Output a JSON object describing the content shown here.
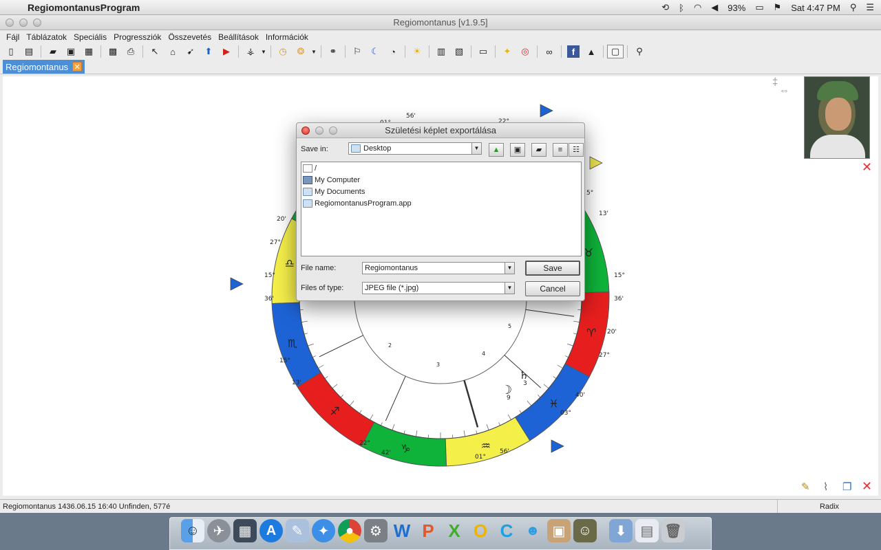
{
  "menubar": {
    "app_name": "RegiomontanusProgram",
    "battery": "93%",
    "clock": "Sat 4:47 PM"
  },
  "window": {
    "title": "Regiomontanus [v1.9.5]",
    "menu": [
      "Fájl",
      "Táblázatok",
      "Speciális",
      "Progressziók",
      "Összevetés",
      "Beállítások",
      "Információk"
    ],
    "tab_label": "Regiomontanus"
  },
  "chart_labels": {
    "top_left_deg": "56'",
    "top_left_minute": "01°",
    "top_right": "22°",
    "right_upper_1": "5°",
    "right_upper_2": "13'",
    "right_15": "15°",
    "right_36": "36'",
    "right_20": "20'",
    "right_27": "27°",
    "right_40": "40'",
    "right_03": "03°",
    "bottom_56": "56'",
    "bottom_01": "01°",
    "bottom_42": "42'",
    "bottom_22": "22°",
    "left_13": "13'",
    "left_15b": "15°",
    "left_36": "36'",
    "left_15": "15°",
    "left_27": "27°",
    "left_20": "20'",
    "house_2": "2",
    "house_3": "3",
    "house_4": "4",
    "house_5": "5",
    "moon_deg": "9",
    "saturn_deg": "3"
  },
  "statusbar": {
    "info": "Regiomontanus 1436.06.15 16:40 Unfinden,    577é",
    "mode": "Radix"
  },
  "dialog": {
    "title": "Születési képlet exportálása",
    "save_in_label": "Save in:",
    "save_in_value": "Desktop",
    "files": [
      {
        "name": "/",
        "icon": "doc"
      },
      {
        "name": "My Computer",
        "icon": "pc"
      },
      {
        "name": "My Documents",
        "icon": "folder"
      },
      {
        "name": "RegiomontanusProgram.app",
        "icon": "folder"
      }
    ],
    "file_name_label": "File name:",
    "file_name_value": "Regiomontanus",
    "file_type_label": "Files of type:",
    "file_type_value": "JPEG file (*.jpg)",
    "save_button": "Save",
    "cancel_button": "Cancel"
  },
  "dock": {
    "items": [
      "finder",
      "launchpad",
      "mission-control",
      "app-store",
      "preview",
      "safari",
      "chrome",
      "system-prefs",
      "word",
      "powerpoint",
      "excel",
      "outlook",
      "skype",
      "communicator",
      "package",
      "regiomontanus",
      "downloads",
      "documents",
      "trash"
    ]
  }
}
